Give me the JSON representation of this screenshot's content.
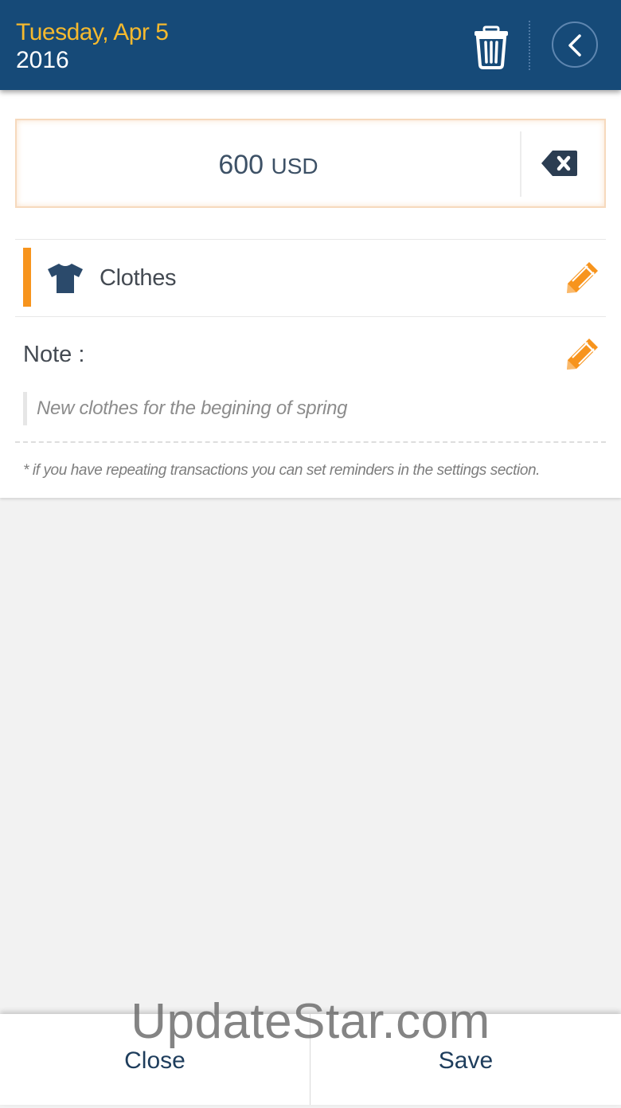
{
  "header": {
    "date": "Tuesday, Apr 5",
    "year": "2016"
  },
  "amount": {
    "value": "600",
    "currency": "USD"
  },
  "category": {
    "label": "Clothes",
    "icon": "tshirt-icon",
    "accent_color": "#f7941d"
  },
  "note": {
    "label": "Note :",
    "value": "New clothes for the begining of spring"
  },
  "hint": "* if you have repeating transactions you can set reminders in the settings section.",
  "footer": {
    "close_label": "Close",
    "save_label": "Save"
  },
  "watermark": "UpdateStar.com",
  "colors": {
    "header_bg": "#164a78",
    "date_text": "#f5b92e",
    "edit_icon": "#f7941d",
    "icon_dark": "#2b4a6b"
  }
}
